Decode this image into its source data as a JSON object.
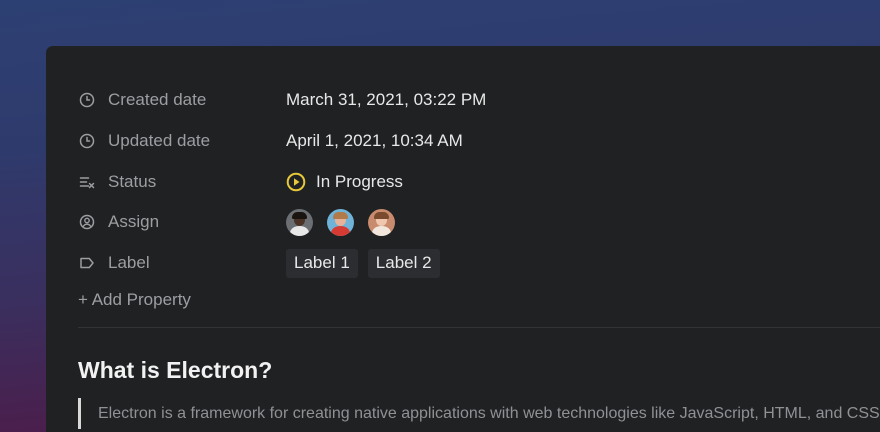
{
  "properties": {
    "created": {
      "label": "Created date",
      "value": "March 31, 2021, 03:22 PM",
      "icon": "clock-icon"
    },
    "updated": {
      "label": "Updated date",
      "value": "April 1, 2021, 10:34 AM",
      "icon": "clock-icon"
    },
    "status": {
      "label": "Status",
      "value": "In Progress",
      "icon": "list-check-icon",
      "status_color": "#e7c83a"
    },
    "assign": {
      "label": "Assign",
      "icon": "user-circle-icon",
      "avatars": [
        "avatar-1",
        "avatar-2",
        "avatar-3"
      ]
    },
    "label": {
      "label": "Label",
      "icon": "tag-icon",
      "tags": [
        "Label 1",
        "Label 2"
      ]
    }
  },
  "add_property": "+ Add Property",
  "content": {
    "heading": "What is Electron?",
    "quote": "Electron is a framework for creating native applications with web technologies like JavaScript, HTML, and CSS."
  },
  "colors": {
    "panel": "#1f2123",
    "label_text": "#9c9ea1",
    "value_text": "#e8e8e8",
    "status": "#e7c83a"
  }
}
